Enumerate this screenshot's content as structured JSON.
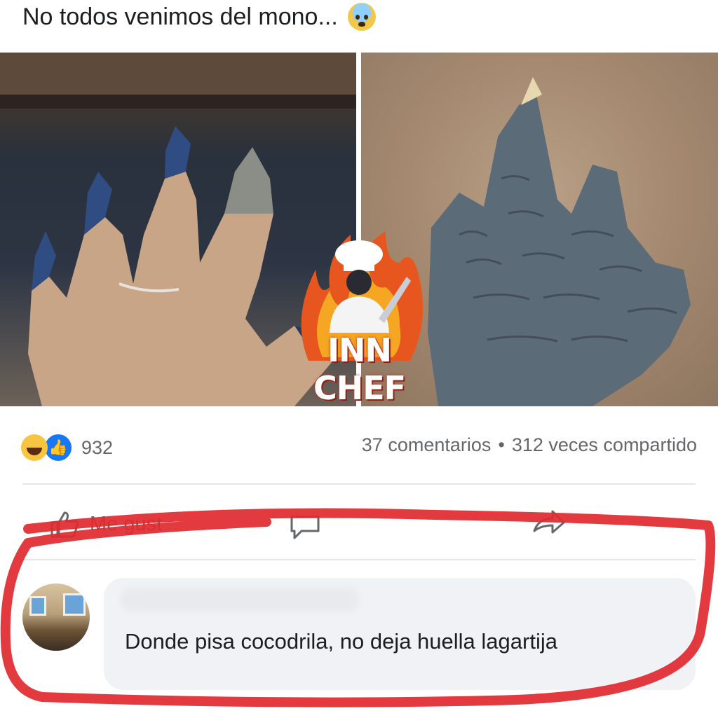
{
  "post": {
    "text": "No todos venimos del mono...",
    "emoji_icon": "anxious-face-emoji-icon"
  },
  "media": {
    "watermark_text": "INN CHEF",
    "left_photo": "hand-with-blue-nails-photo",
    "right_photo": "crocodile-foot-in-sand-photo"
  },
  "stats": {
    "reaction_count": "932",
    "comments": "37 comentarios",
    "separator": "•",
    "shares": "312 veces compartido"
  },
  "actions": {
    "like_label": "Me gust"
  },
  "comment": {
    "text": "Donde pisa cocodrila,  no deja huella lagartija"
  },
  "colors": {
    "like_blue": "#1877f2",
    "haha_yellow": "#f7c53f",
    "highlight_red": "#e0292f",
    "bubble_bg": "#f0f2f5",
    "muted_text": "#65676b"
  }
}
